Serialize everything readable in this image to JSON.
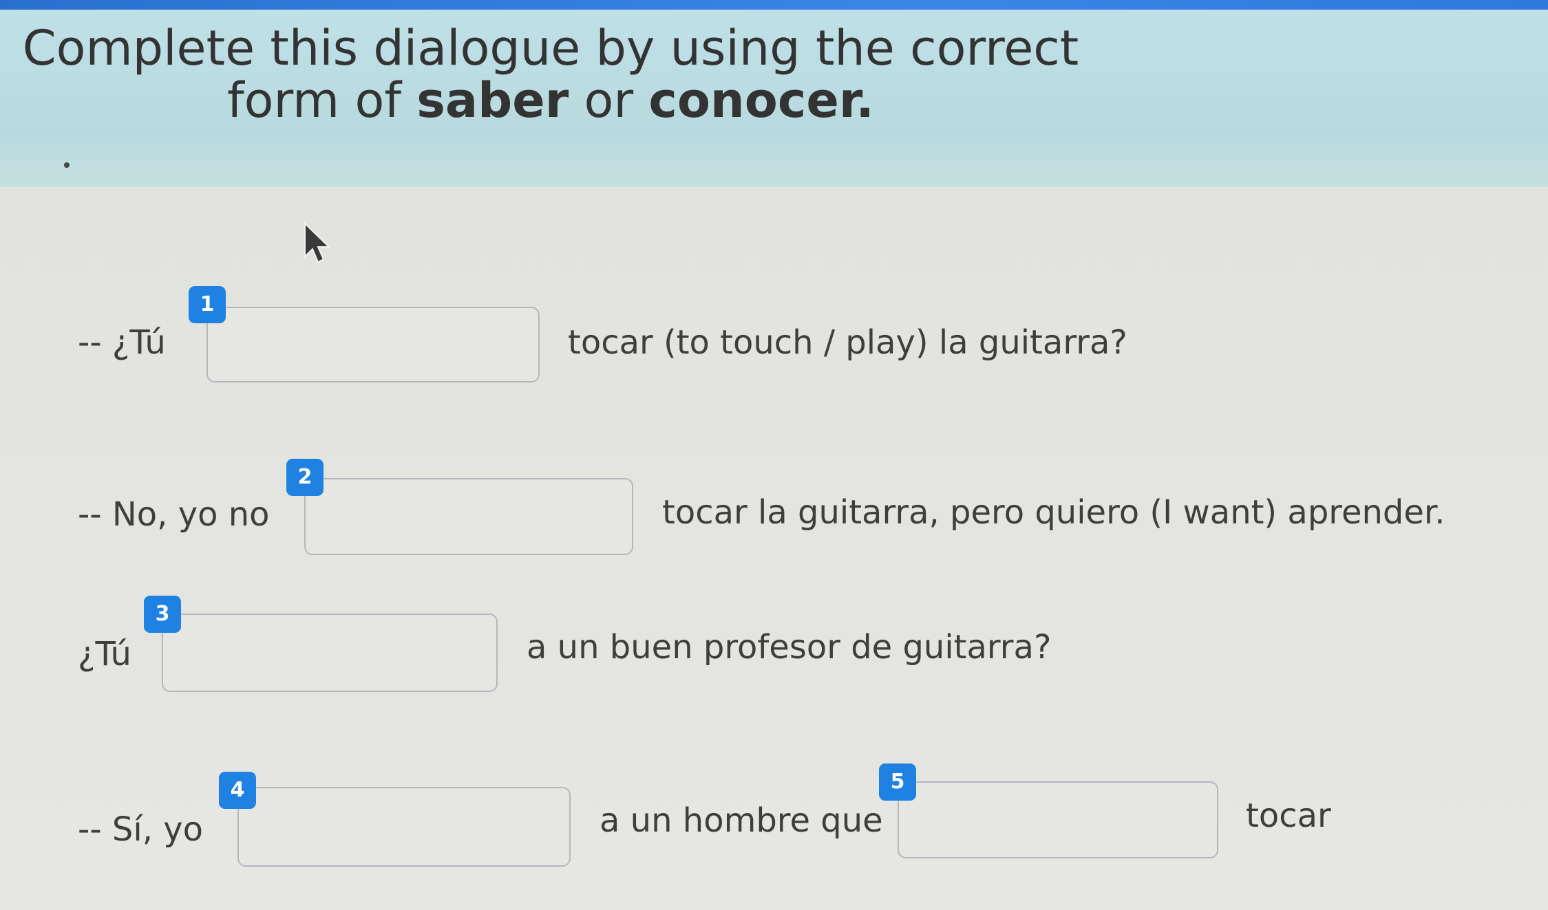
{
  "header": {
    "title_line1": "Complete this dialogue by using the correct",
    "title_line2_prefix": "form of ",
    "title_bold1": "saber",
    "title_or": " or ",
    "title_bold2": "conocer",
    "title_period": "."
  },
  "dialogue": {
    "line1": {
      "before": "-- ¿Tú",
      "badge": "1",
      "after": "tocar (to touch / play) la guitarra?"
    },
    "line2": {
      "before": "-- No, yo no",
      "badge": "2",
      "after": "tocar la guitarra, pero quiero (I want) aprender."
    },
    "line3": {
      "before": "¿Tú",
      "badge": "3",
      "after": "a un buen profesor de guitarra?"
    },
    "line4": {
      "before": "-- Sí, yo",
      "badge": "4",
      "middle": "a un hombre que",
      "badge2": "5",
      "after": "tocar"
    }
  },
  "colors": {
    "badge": "#1f82e2",
    "header_bg": "#bfe0e6",
    "topbar": "#2f78de"
  },
  "icons": {
    "cursor": "mouse-pointer-icon"
  }
}
